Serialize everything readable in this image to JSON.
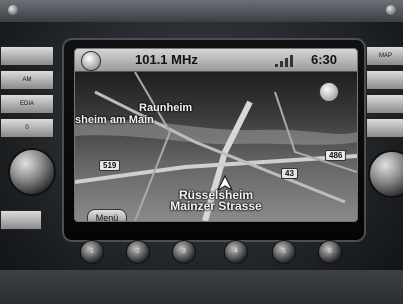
{
  "status_bar": {
    "frequency": "101.1 MHz",
    "clock": "6:30"
  },
  "map": {
    "place_raunheim": "Raunheim",
    "place_sheim_am_main": "sheim am Main",
    "place_russelsheim": "Rüsselsheim",
    "route_519": "519",
    "route_486": "486",
    "route_43": "43",
    "street_name": "Mainzer Strasse"
  },
  "menu_button": "Menü",
  "left_panel": {
    "button_2": "AM",
    "button_3": "EDIA",
    "button_4": "0"
  },
  "right_panel": {
    "button_1": "MAP"
  },
  "presets": [
    "1",
    "2",
    "3",
    "4",
    "5",
    "6"
  ]
}
